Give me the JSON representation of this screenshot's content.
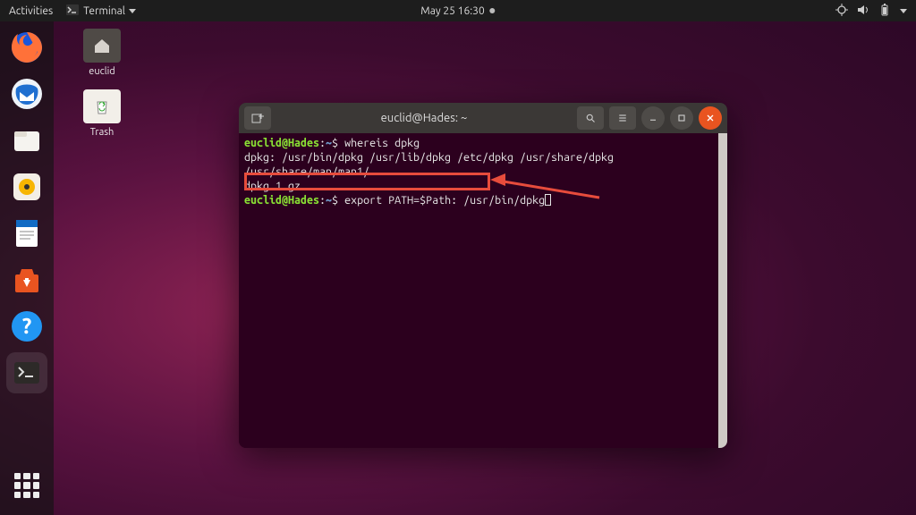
{
  "topbar": {
    "activities": "Activities",
    "app_menu": "Terminal",
    "datetime": "May 25  16:30"
  },
  "desktop": {
    "home_label": "euclid",
    "trash_label": "Trash"
  },
  "terminal": {
    "title": "euclid@Hades: ~",
    "prompt_user_host": "euclid@Hades",
    "prompt_path": "~",
    "cmd1": "whereis dpkg",
    "out1": "dpkg: /usr/bin/dpkg /usr/lib/dpkg /etc/dpkg /usr/share/dpkg /usr/share/man/man1/",
    "out1b": "dpkg.1.gz",
    "cmd2": "export PATH=$Path: /usr/bin/dpkg"
  }
}
